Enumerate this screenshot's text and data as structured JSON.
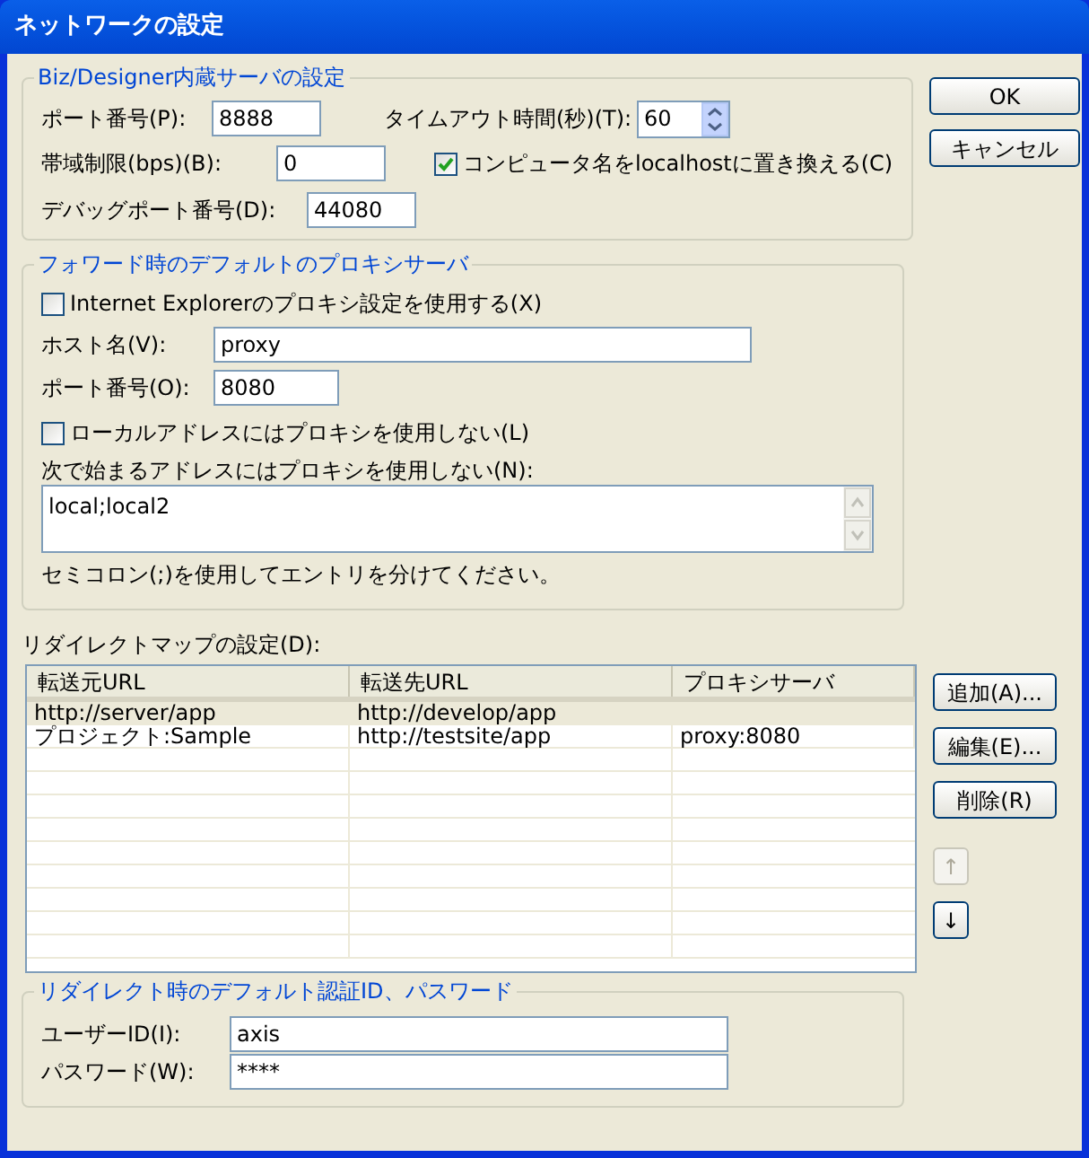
{
  "window": {
    "title": "ネットワークの設定"
  },
  "server_settings": {
    "title": "Biz/Designer内蔵サーバの設定",
    "port": {
      "label": "ポート番号(P):",
      "value": "8888"
    },
    "timeout": {
      "label": "タイムアウト時間(秒)(T):",
      "value": "60"
    },
    "bandwidth": {
      "label": "帯域制限(bps)(B):",
      "value": "0"
    },
    "replace_localhost": {
      "label": "コンピュータ名をlocalhostに置き換える(C)",
      "checked": true
    },
    "debug_port": {
      "label": "デバッグポート番号(D):",
      "value": "44080"
    }
  },
  "proxy": {
    "title": "フォワード時のデフォルトのプロキシサーバ",
    "use_ie": {
      "label": "Internet Explorerのプロキシ設定を使用する(X)",
      "checked": false
    },
    "host": {
      "label": "ホスト名(V):",
      "value": "proxy"
    },
    "port": {
      "label": "ポート番号(O):",
      "value": "8080"
    },
    "no_local": {
      "label": "ローカルアドレスにはプロキシを使用しない(L)",
      "checked": false
    },
    "exceptions": {
      "label": "次で始まるアドレスにはプロキシを使用しない(N):",
      "value": "local;local2"
    },
    "note": "セミコロン(;)を使用してエントリを分けてください。"
  },
  "redirect_map": {
    "label": "リダイレクトマップの設定(D):",
    "columns": [
      "転送元URL",
      "転送先URL",
      "プロキシサーバ"
    ],
    "rows": [
      {
        "cells": [
          "http://server/app",
          "http://develop/app",
          ""
        ],
        "selected": true
      },
      {
        "cells": [
          "プロジェクト:Sample",
          "http://testsite/app",
          "proxy:8080"
        ],
        "selected": false
      }
    ],
    "buttons": [
      {
        "label": "追加(A)...",
        "disabled": false
      },
      {
        "label": "編集(E)...",
        "disabled": false
      },
      {
        "label": "削除(R)",
        "disabled": false
      },
      {
        "label": "↑",
        "disabled": true
      },
      {
        "label": "↓",
        "disabled": false
      }
    ]
  },
  "redirect_auth": {
    "title": "リダイレクト時のデフォルト認証ID、パスワード",
    "user": {
      "label": "ユーザーID(I):",
      "value": "axis"
    },
    "password": {
      "label": "パスワード(W):",
      "value": "****"
    }
  },
  "buttons": [
    "OK",
    "キャンセル"
  ]
}
